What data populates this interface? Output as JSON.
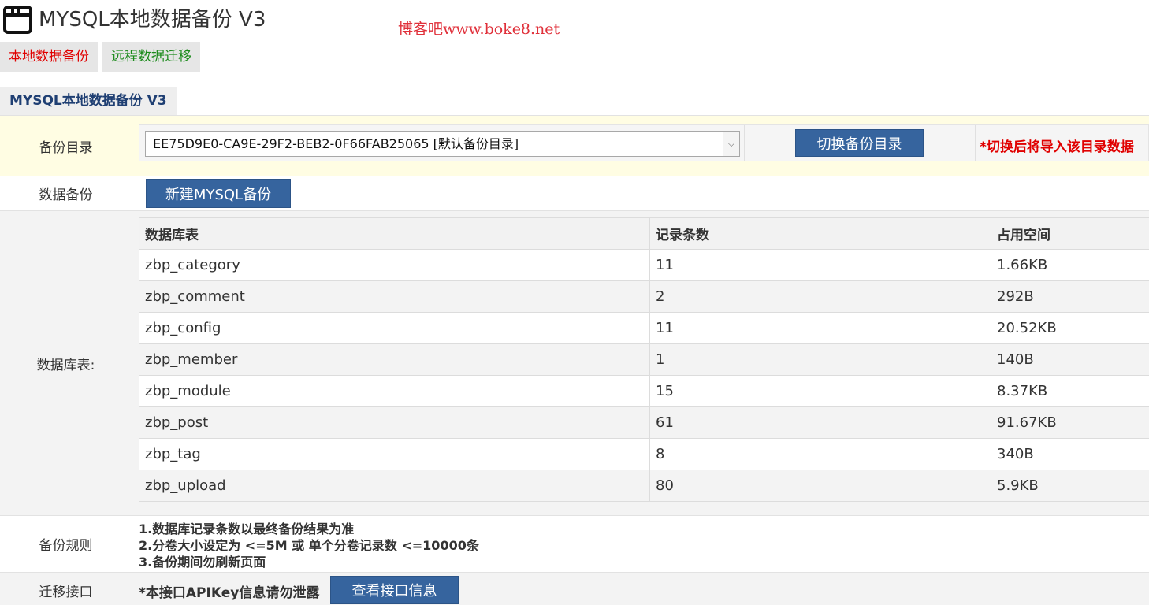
{
  "header": {
    "title": "MYSQL本地数据备份 V3",
    "icon": "app-window-icon",
    "watermark": "博客吧www.boke8.net"
  },
  "tabs": [
    {
      "label": "本地数据备份",
      "color": "#e00000"
    },
    {
      "label": "远程数据迁移",
      "color": "#1b8a1b"
    }
  ],
  "section_title": "MYSQL本地数据备份 V3",
  "backup_dir": {
    "label": "备份目录",
    "selected": "EE75D9E0-CA9E-29F2-BEB2-0F66FAB25065 [默认备份目录]",
    "switch_button": "切换备份目录",
    "warning": "*切换后将导入该目录数据"
  },
  "data_backup": {
    "label": "数据备份",
    "button": "新建MYSQL备份"
  },
  "db_tables": {
    "label": "数据库表:",
    "headers": [
      "数据库表",
      "记录条数",
      "占用空间"
    ],
    "rows": [
      [
        "zbp_category",
        "11",
        "1.66KB"
      ],
      [
        "zbp_comment",
        "2",
        "292B"
      ],
      [
        "zbp_config",
        "11",
        "20.52KB"
      ],
      [
        "zbp_member",
        "1",
        "140B"
      ],
      [
        "zbp_module",
        "15",
        "8.37KB"
      ],
      [
        "zbp_post",
        "61",
        "91.67KB"
      ],
      [
        "zbp_tag",
        "8",
        "340B"
      ],
      [
        "zbp_upload",
        "80",
        "5.9KB"
      ]
    ]
  },
  "rules": {
    "label": "备份规则",
    "lines": [
      "1.数据库记录条数以最终备份结果为准",
      "2.分卷大小设定为 <=5M 或 单个分卷记录数 <=10000条",
      "3.备份期间勿刷新页面"
    ]
  },
  "migrate": {
    "label": "迁移接口",
    "note": "*本接口APIKey信息请勿泄露",
    "button": "查看接口信息"
  },
  "colors": {
    "button_bg": "#36649e",
    "warning": "#e00000",
    "section_title": "#1f3f73",
    "highlight_row": "#fffde3"
  }
}
